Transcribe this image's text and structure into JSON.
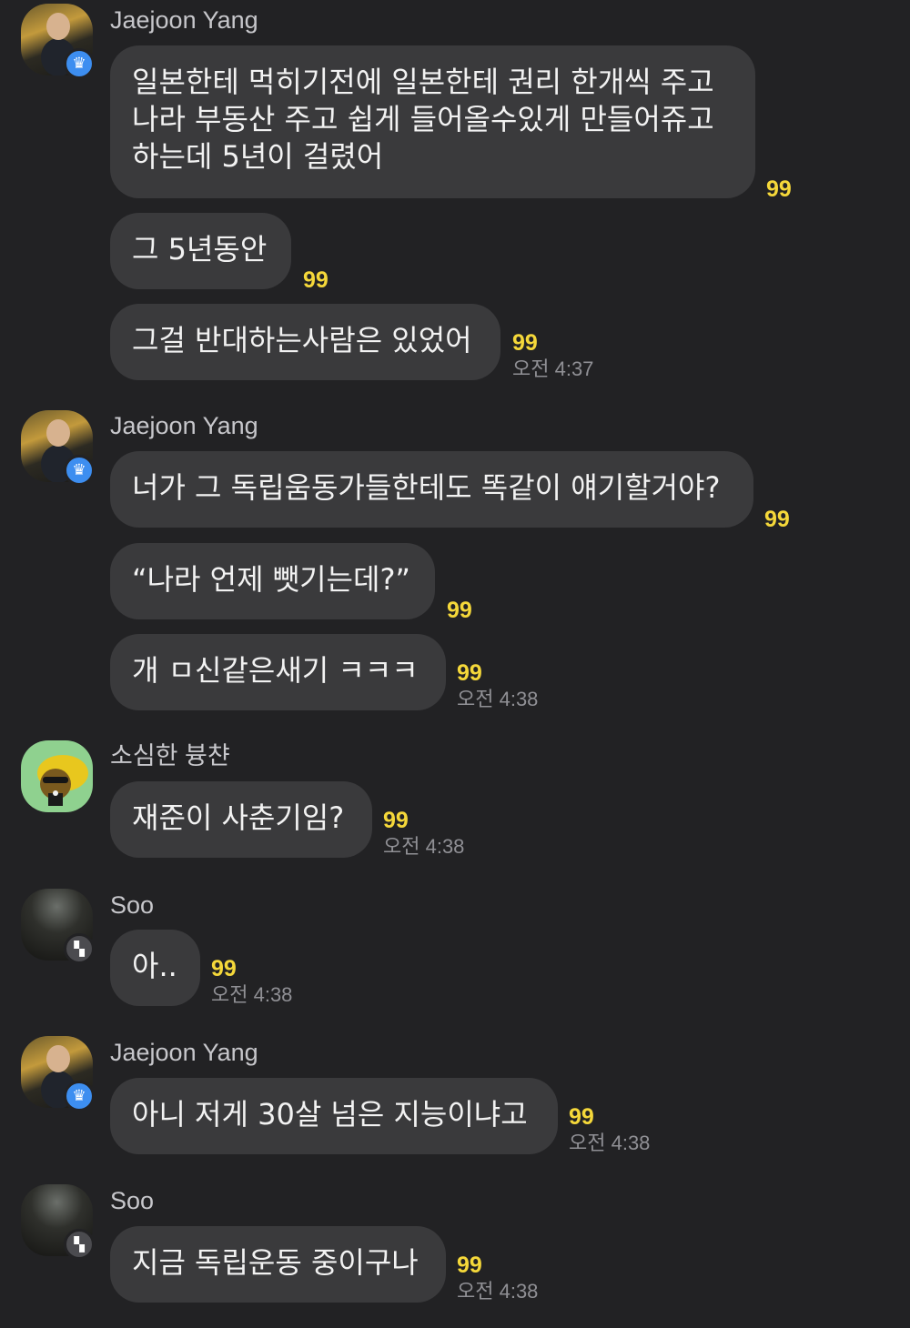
{
  "chat": {
    "groups": [
      {
        "sender": "Jaejoon Yang",
        "avatar_icon": "profile-photo-icon",
        "badge_icon": "crown-icon",
        "messages": [
          {
            "lines": [
              "일본한테 먹히기전에 일본한테 권리 한개씩 주고",
              "나라 부동산 주고 쉽게 들어올수있게 만들어쥬고",
              "하는데 5년이 걸렸어"
            ],
            "unread": "99",
            "time": ""
          },
          {
            "lines": [
              "그 5년동안"
            ],
            "unread": "99",
            "time": ""
          },
          {
            "lines": [
              "그걸 반대하는사람은 있었어"
            ],
            "unread": "99",
            "time": "오전 4:37"
          }
        ]
      },
      {
        "sender": "Jaejoon Yang",
        "avatar_icon": "profile-photo-icon",
        "badge_icon": "crown-icon",
        "messages": [
          {
            "lines": [
              "너가 그 독립움동가들한테도 똑같이 얘기할거야?"
            ],
            "unread": "99",
            "time": ""
          },
          {
            "lines": [
              "“나라 언제 뺏기는데?”"
            ],
            "unread": "99",
            "time": ""
          },
          {
            "lines": [
              "개 ㅁ신같은새기 ㅋㅋㅋ"
            ],
            "unread": "99",
            "time": "오전 4:38"
          }
        ]
      },
      {
        "sender": "소심한 븅챤",
        "avatar_icon": "cartoon-character-icon",
        "badge_icon": "",
        "messages": [
          {
            "lines": [
              "재준이 사춘기임?"
            ],
            "unread": "99",
            "time": "오전 4:38"
          }
        ]
      },
      {
        "sender": "Soo",
        "avatar_icon": "profile-photo-icon",
        "badge_icon": "open-profile-icon",
        "messages": [
          {
            "lines": [
              "아.."
            ],
            "unread": "99",
            "time": "오전 4:38"
          }
        ]
      },
      {
        "sender": "Jaejoon Yang",
        "avatar_icon": "profile-photo-icon",
        "badge_icon": "crown-icon",
        "messages": [
          {
            "lines": [
              "아니 저게 30살 넘은 지능이냐고"
            ],
            "unread": "99",
            "time": "오전 4:38"
          }
        ]
      },
      {
        "sender": "Soo",
        "avatar_icon": "profile-photo-icon",
        "badge_icon": "open-profile-icon",
        "messages": [
          {
            "lines": [
              "지금 독립운동 중이구나"
            ],
            "unread": "99",
            "time": "오전 4:38"
          }
        ]
      }
    ]
  },
  "colors": {
    "background": "#222224",
    "bubble": "#3a3a3c",
    "text": "#f2f2f2",
    "sender": "#c7c7cb",
    "unread": "#f5d83a",
    "time": "#909095",
    "crown_badge": "#3d8ef0"
  }
}
